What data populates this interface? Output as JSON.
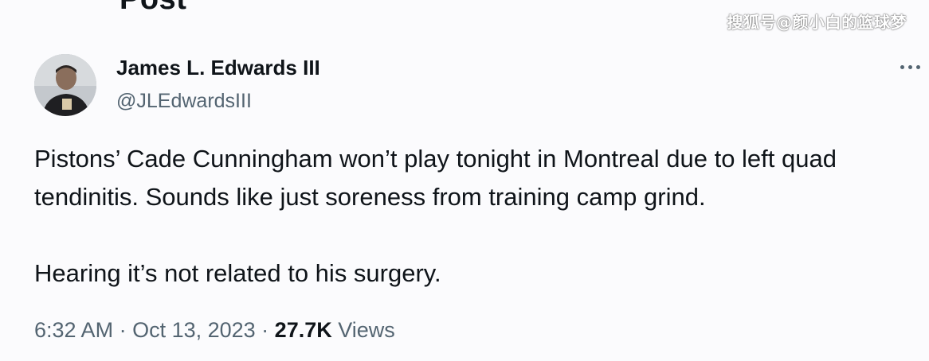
{
  "header": {
    "title": "Post"
  },
  "watermark": "搜狐号@颜小白的篮球梦",
  "author": {
    "name": "James L. Edwards III",
    "handle": "@JLEdwardsIII",
    "avatar_icon": "profile-photo"
  },
  "post": {
    "paragraphs": [
      "Pistons’ Cade Cunningham won’t play tonight in Montreal due to left quad tendinitis. Sounds like just soreness from training camp grind.",
      "Hearing it’s not related to his surgery."
    ]
  },
  "meta": {
    "time": "6:32 AM",
    "separator": " · ",
    "date": "Oct 13, 2023",
    "views_count": "27.7K",
    "views_label": "Views"
  },
  "colors": {
    "text_primary": "#0f1419",
    "text_secondary": "#536471",
    "background": "#fbfbfd"
  },
  "icons": {
    "more": "more-horizontal-icon"
  }
}
